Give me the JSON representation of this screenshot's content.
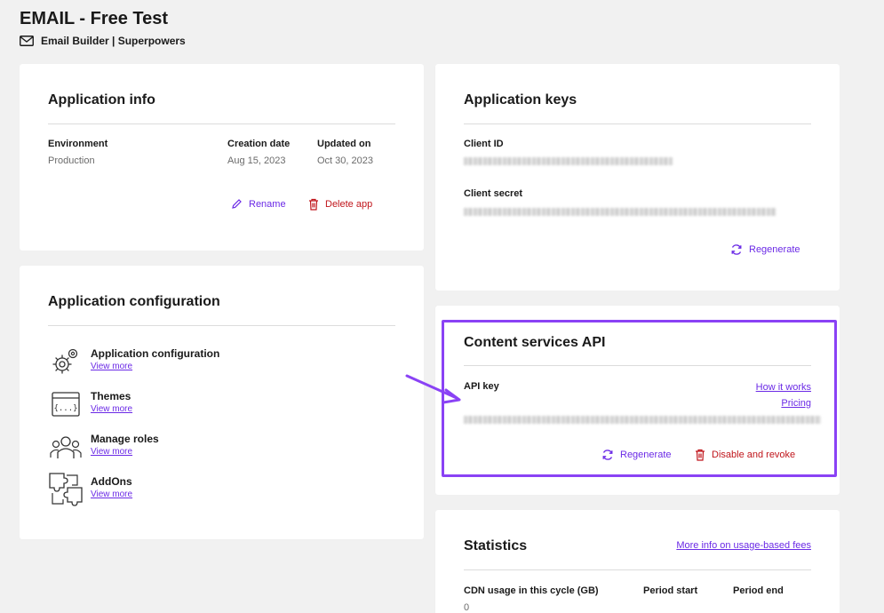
{
  "header": {
    "title": "EMAIL - Free Test",
    "subtitle": "Email Builder | Superpowers",
    "subtitle_icon": "envelope-icon"
  },
  "app_info": {
    "title": "Application info",
    "environment_label": "Environment",
    "environment_value": "Production",
    "creation_label": "Creation date",
    "creation_value": "Aug 15, 2023",
    "updated_label": "Updated on",
    "updated_value": "Oct 30, 2023",
    "rename_label": "Rename",
    "delete_label": "Delete app"
  },
  "app_config": {
    "title": "Application configuration",
    "items": [
      {
        "name": "Application configuration",
        "link": "View more",
        "icon": "gears-icon"
      },
      {
        "name": "Themes",
        "link": "View more",
        "icon": "code-window-icon"
      },
      {
        "name": "Manage roles",
        "link": "View more",
        "icon": "users-icon"
      },
      {
        "name": "AddOns",
        "link": "View more",
        "icon": "puzzle-icon"
      }
    ]
  },
  "app_keys": {
    "title": "Application keys",
    "client_id_label": "Client ID",
    "client_secret_label": "Client secret",
    "regenerate_label": "Regenerate"
  },
  "content_api": {
    "title": "Content services API",
    "api_key_label": "API key",
    "how_it_works": "How it works",
    "pricing": "Pricing",
    "regenerate_label": "Regenerate",
    "disable_label": "Disable and revoke"
  },
  "statistics": {
    "title": "Statistics",
    "more_info": "More info on usage-based fees",
    "cdn_label": "CDN usage in this cycle (GB)",
    "period_start_label": "Period start",
    "period_end_label": "Period end",
    "cdn_value": "0"
  },
  "colors": {
    "accent": "#6b2ae6",
    "danger": "#c0151b",
    "highlight": "#8a42f5",
    "background": "#f1f1f1"
  }
}
